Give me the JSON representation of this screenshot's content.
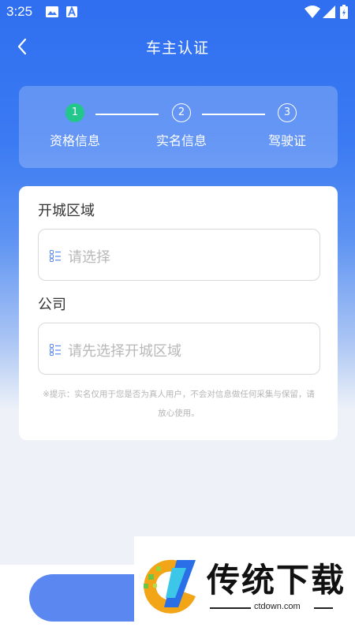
{
  "status_bar": {
    "time": "3:25",
    "icons": [
      "image-icon",
      "a-icon",
      "wifi-icon",
      "signal-icon",
      "battery-icon"
    ]
  },
  "header": {
    "title": "车主认证",
    "back_icon": "chevron-left-icon"
  },
  "steps": [
    {
      "number": "1",
      "label": "资格信息",
      "active": true
    },
    {
      "number": "2",
      "label": "实名信息",
      "active": false
    },
    {
      "number": "3",
      "label": "驾驶证",
      "active": false
    }
  ],
  "form": {
    "city": {
      "label": "开城区域",
      "placeholder": "请选择",
      "icon": "list-icon"
    },
    "company": {
      "label": "公司",
      "placeholder": "请先选择开城区域",
      "icon": "list-icon"
    },
    "hint": "※提示：实名仅用于您是否为真人用户，不会对信息做任何采集与保留，请放心使用。"
  },
  "watermark": {
    "text": "传统下载",
    "url": "ctdown.com"
  },
  "colors": {
    "primary": "#2f6ff0",
    "step_active": "#23c68b",
    "button": "#5a88f0",
    "placeholder": "#b8b8b8"
  }
}
